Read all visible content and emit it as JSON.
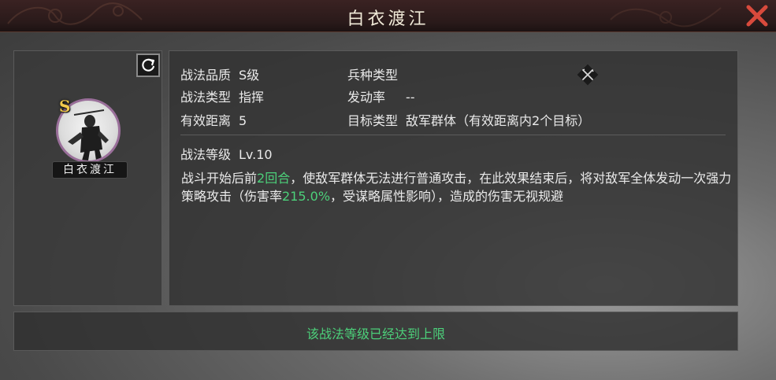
{
  "header": {
    "title": "白衣渡江"
  },
  "skill": {
    "grade_badge": "S",
    "name": "白衣渡江",
    "attributes": {
      "quality_label": "战法品质",
      "quality_value": "S级",
      "type_label": "战法类型",
      "type_value": "指挥",
      "range_label": "有效距离",
      "range_value": "5",
      "unit_label": "兵种类型",
      "unit_icon": "crossed-weapons-icon",
      "trigger_label": "发动率",
      "trigger_value": "--",
      "target_label": "目标类型",
      "target_value": "敌军群体（有效距离内2个目标）"
    },
    "level_label": "战法等级",
    "level_value": "Lv.10",
    "description": {
      "part1": "战斗开始后前",
      "highlight1": "2回合",
      "part2": "，使敌军群体无法进行普通攻击，在此效果结束后，将对敌军全体发动一次强力策略攻击（伤害率",
      "highlight2": "215.0%",
      "part3": "，受谋略属性影响），造成的伤害无视规避"
    },
    "max_level_message": "该战法等级已经达到上限"
  },
  "colors": {
    "highlight": "#4cd07a",
    "grade_badge": "#f2c94c",
    "close_icon": "#d84a3c",
    "portrait_ring": "#9a6f9a"
  }
}
